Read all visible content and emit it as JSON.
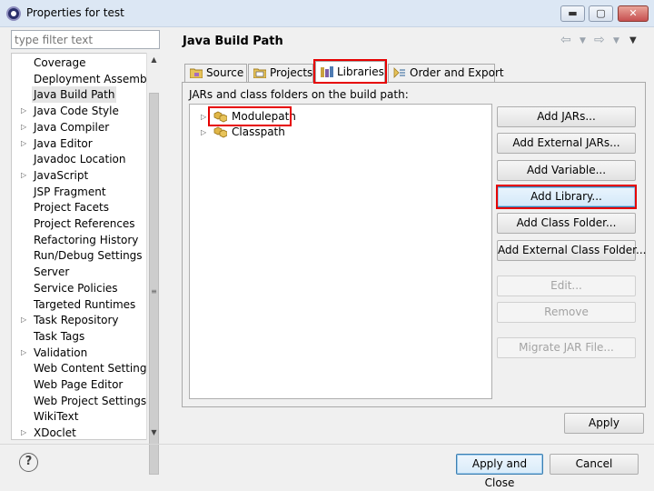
{
  "window": {
    "title": "Properties for test",
    "controls": {
      "minimize": "▬",
      "maximize": "▢",
      "close": "✕"
    }
  },
  "filter": {
    "placeholder": "type filter text"
  },
  "nav": {
    "items": [
      {
        "label": "Coverage",
        "expandable": false
      },
      {
        "label": "Deployment Assembly",
        "expandable": false
      },
      {
        "label": "Java Build Path",
        "expandable": false,
        "selected": true
      },
      {
        "label": "Java Code Style",
        "expandable": true
      },
      {
        "label": "Java Compiler",
        "expandable": true
      },
      {
        "label": "Java Editor",
        "expandable": true
      },
      {
        "label": "Javadoc Location",
        "expandable": false
      },
      {
        "label": "JavaScript",
        "expandable": true
      },
      {
        "label": "JSP Fragment",
        "expandable": false
      },
      {
        "label": "Project Facets",
        "expandable": false
      },
      {
        "label": "Project References",
        "expandable": false
      },
      {
        "label": "Refactoring History",
        "expandable": false
      },
      {
        "label": "Run/Debug Settings",
        "expandable": false
      },
      {
        "label": "Server",
        "expandable": false
      },
      {
        "label": "Service Policies",
        "expandable": false
      },
      {
        "label": "Targeted Runtimes",
        "expandable": false
      },
      {
        "label": "Task Repository",
        "expandable": true
      },
      {
        "label": "Task Tags",
        "expandable": false
      },
      {
        "label": "Validation",
        "expandable": true
      },
      {
        "label": "Web Content Settings",
        "expandable": false
      },
      {
        "label": "Web Page Editor",
        "expandable": false
      },
      {
        "label": "Web Project Settings",
        "expandable": false
      },
      {
        "label": "WikiText",
        "expandable": false
      },
      {
        "label": "XDoclet",
        "expandable": true
      }
    ]
  },
  "page": {
    "title": "Java Build Path"
  },
  "tabs": [
    {
      "label": "Source",
      "icon": "source-folder-icon"
    },
    {
      "label": "Projects",
      "icon": "projects-icon"
    },
    {
      "label": "Libraries",
      "icon": "libraries-icon",
      "active": true
    },
    {
      "label": "Order and Export",
      "icon": "order-export-icon"
    }
  ],
  "build_path": {
    "label": "JARs and class folders on the build path:",
    "entries": [
      {
        "label": "Modulepath",
        "icon": "container-icon"
      },
      {
        "label": "Classpath",
        "icon": "container-icon"
      }
    ]
  },
  "buttons": {
    "add_jars": "Add JARs...",
    "add_external_jars": "Add External JARs...",
    "add_variable": "Add Variable...",
    "add_library": "Add Library...",
    "add_class_folder": "Add Class Folder...",
    "add_external_class_folder": "Add External Class Folder...",
    "edit": "Edit...",
    "remove": "Remove",
    "migrate_jar": "Migrate JAR File...",
    "apply": "Apply",
    "apply_and_close": "Apply and Close",
    "cancel": "Cancel"
  },
  "help": {
    "symbol": "?"
  },
  "colors": {
    "highlight": "#e60000",
    "accent": "#3c7fb1"
  }
}
